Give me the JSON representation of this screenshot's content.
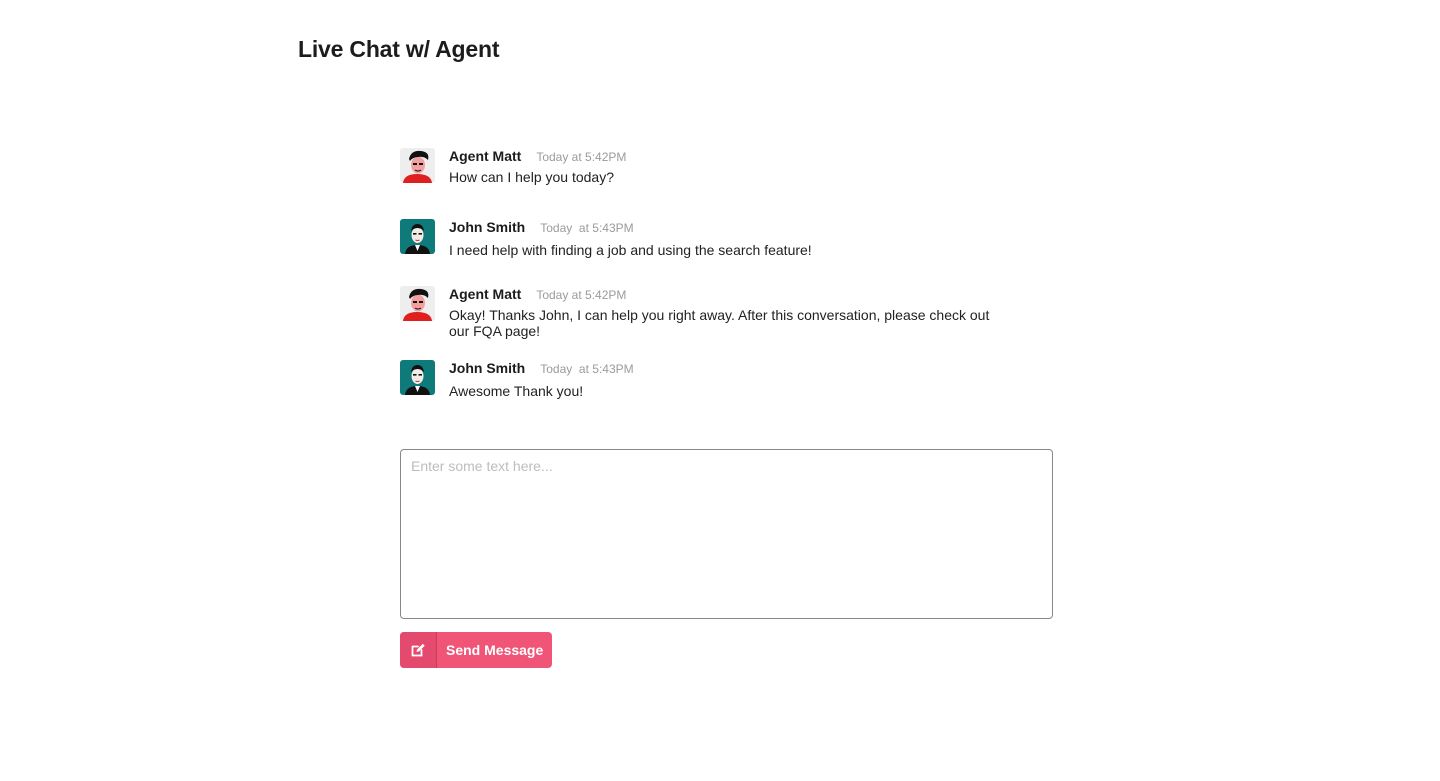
{
  "page": {
    "title": "Live Chat w/ Agent"
  },
  "messages": [
    {
      "author": "Agent Matt",
      "time": "Today at 5:42PM",
      "text": "How can I help you today?",
      "avatar": "agent-avatar"
    },
    {
      "author": "John Smith",
      "time": "Today  at 5:43PM",
      "text": "I need help with finding a job and using the search feature!",
      "avatar": "user-avatar"
    },
    {
      "author": "Agent Matt",
      "time": "Today at 5:42PM",
      "text": "Okay! Thanks John, I can help you right away. After this conversation, please check out our FQA page!",
      "avatar": "agent-avatar"
    },
    {
      "author": "John Smith",
      "time": "Today  at 5:43PM",
      "text": "Awesome Thank you!",
      "avatar": "user-avatar"
    }
  ],
  "reply": {
    "placeholder": "Enter some text here...",
    "value": "",
    "send_label": "Send Message",
    "send_icon": "edit-icon"
  },
  "colors": {
    "accent": "#f05578",
    "agent_avatar_bg": "#e8e8e8",
    "user_avatar_bg": "#0f7a7a"
  }
}
